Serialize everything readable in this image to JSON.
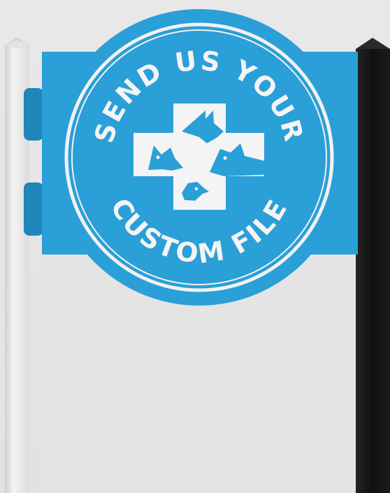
{
  "sign": {
    "top_text": "SEND US YOUR",
    "bottom_text": "CUSTOM FILE",
    "logo": "veterinary-cross-with-animal-heads-icon"
  },
  "colors": {
    "background": "#e6e6e6",
    "sign_blue": "#2a9fd8",
    "sign_blue_dark": "#1f86bb",
    "ring_white": "#f2f2f2",
    "left_post": "#e9e9e9",
    "right_post": "#141414"
  }
}
